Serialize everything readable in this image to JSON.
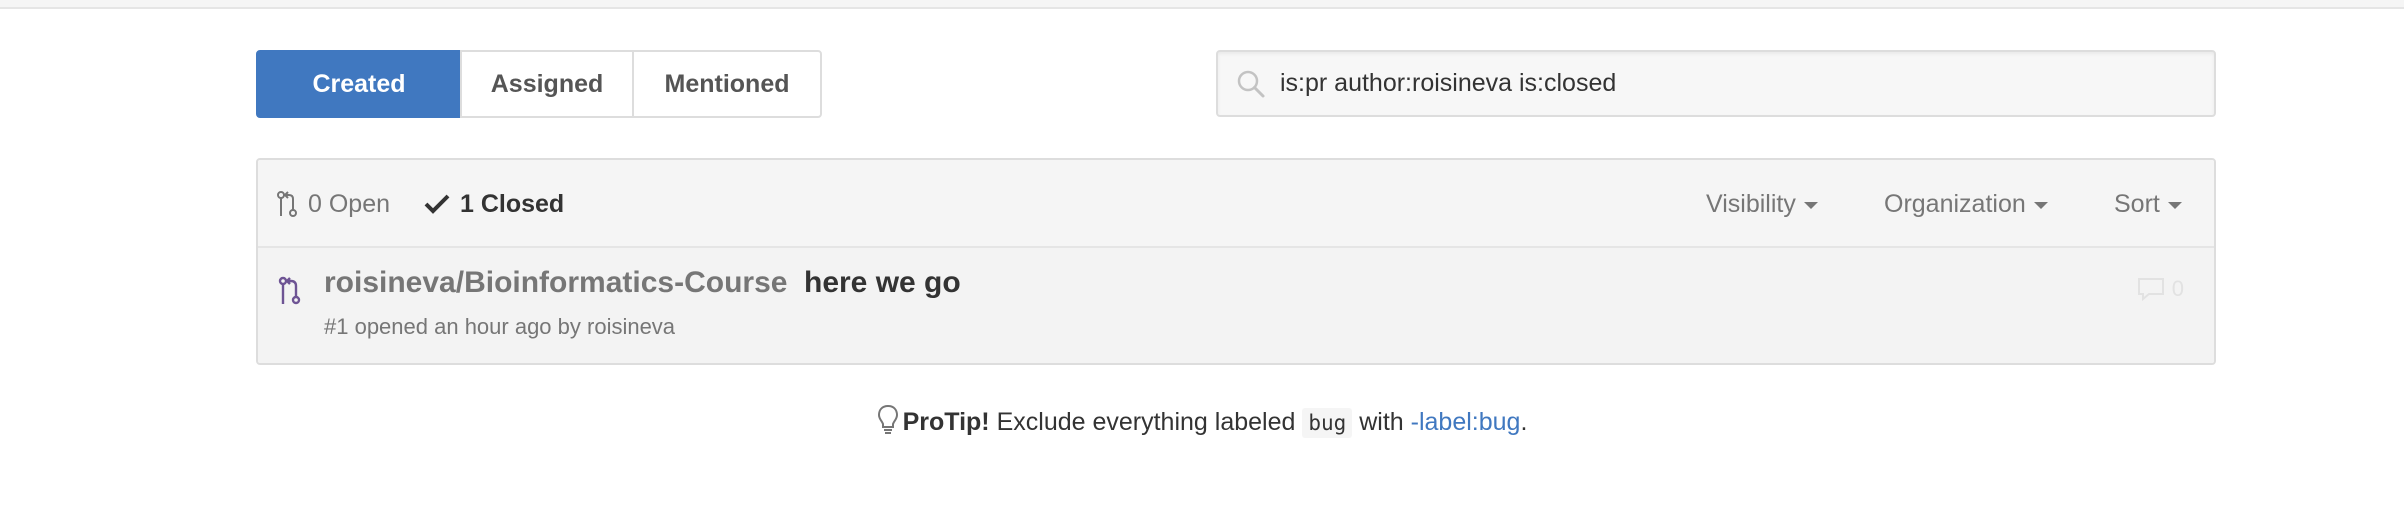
{
  "subnav": {
    "tabs": [
      {
        "label": "Created",
        "selected": true
      },
      {
        "label": "Assigned",
        "selected": false
      },
      {
        "label": "Mentioned",
        "selected": false
      }
    ]
  },
  "search": {
    "value": "is:pr author:roisineva is:closed",
    "icon": "search-icon"
  },
  "states": {
    "open_label": "0 Open",
    "closed_label": "1 Closed"
  },
  "filters": {
    "visibility": "Visibility",
    "organization": "Organization",
    "sort": "Sort"
  },
  "pull_requests": [
    {
      "repo": "roisineva/Bioinformatics-Course",
      "title": "here we go",
      "meta": "#1 opened an hour ago by roisineva",
      "comments": "0"
    }
  ],
  "protip": {
    "label": "ProTip!",
    "text_before": " Exclude everything labeled ",
    "code": "bug",
    "text_middle": " with ",
    "link": "-label:bug",
    "text_after": "."
  },
  "colors": {
    "accent": "#4078c0",
    "pr_closed": "#6e5494"
  }
}
